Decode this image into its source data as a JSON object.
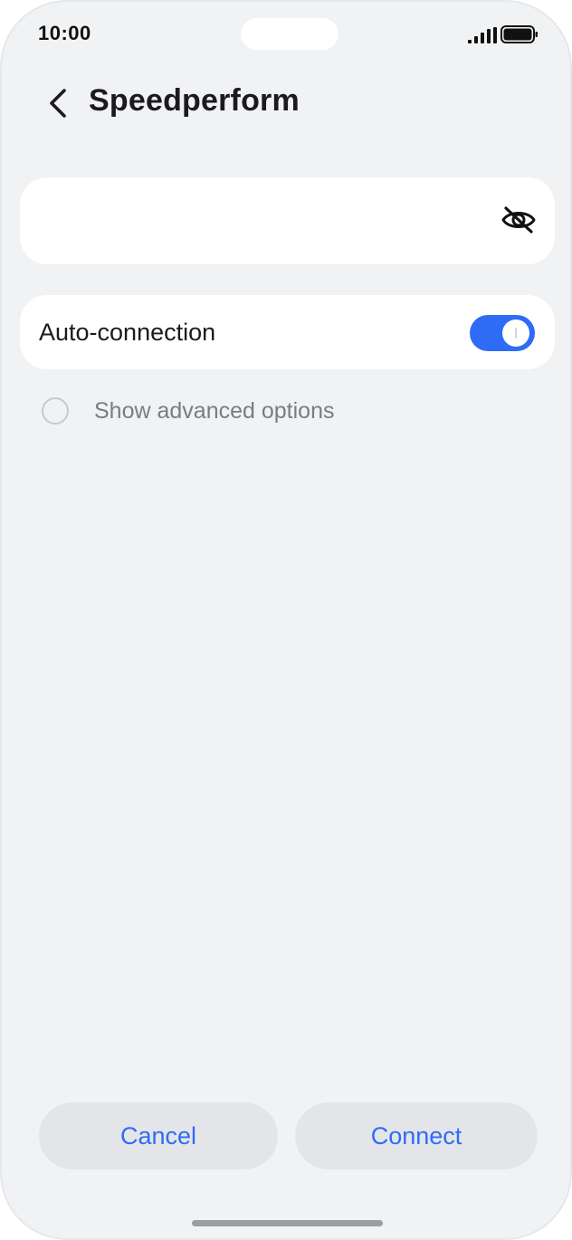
{
  "status_bar": {
    "time": "10:00",
    "signal_icon": "cellular-signal-icon",
    "battery_icon": "battery-icon"
  },
  "header": {
    "back_icon": "chevron-left-icon",
    "title": "Speedperform"
  },
  "password_field": {
    "value": "",
    "placeholder": "",
    "visibility_icon": "eye-slash-icon"
  },
  "auto_connection": {
    "label": "Auto-connection",
    "enabled": true
  },
  "advanced_options": {
    "label": "Show advanced options",
    "checked": false
  },
  "actions": {
    "cancel_label": "Cancel",
    "connect_label": "Connect"
  },
  "colors": {
    "accent": "#2f6cf6",
    "background": "#f1f2f4",
    "card": "#ffffff",
    "button_bg": "#e4e5e8"
  }
}
